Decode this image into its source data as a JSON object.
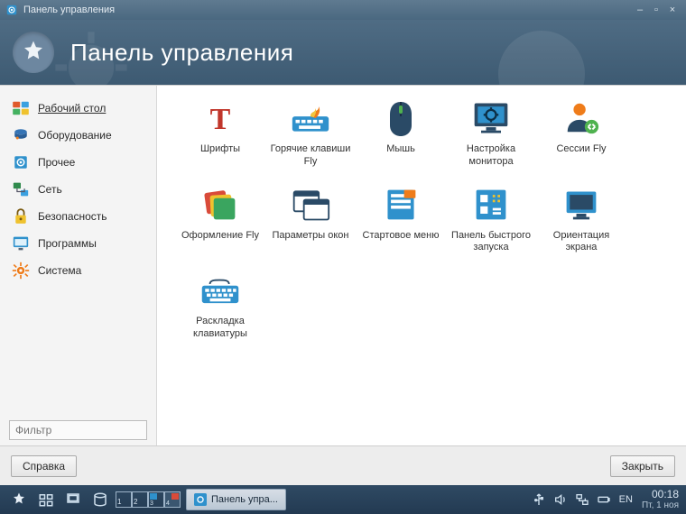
{
  "colors": {
    "accent": "#2f91cc",
    "header": "#456782",
    "orange": "#ef7c1a",
    "green": "#4fb24f"
  },
  "window": {
    "title": "Панель управления"
  },
  "header": {
    "title": "Панель управления"
  },
  "sidebar": {
    "items": [
      {
        "label": "Рабочий стол",
        "icon": "desktop"
      },
      {
        "label": "Оборудование",
        "icon": "hardware"
      },
      {
        "label": "Прочее",
        "icon": "other"
      },
      {
        "label": "Сеть",
        "icon": "network"
      },
      {
        "label": "Безопасность",
        "icon": "security"
      },
      {
        "label": "Программы",
        "icon": "programs"
      },
      {
        "label": "Система",
        "icon": "system"
      }
    ],
    "active_index": 0,
    "filter_placeholder": "Фильтр"
  },
  "content": {
    "tiles": [
      {
        "label": "Шрифты",
        "icon": "fonts"
      },
      {
        "label": "Горячие клавиши Fly",
        "icon": "hotkeys"
      },
      {
        "label": "Мышь",
        "icon": "mouse"
      },
      {
        "label": "Настройка монитора",
        "icon": "monitor-settings"
      },
      {
        "label": "Сессии Fly",
        "icon": "sessions"
      },
      {
        "label": "Оформление Fly",
        "icon": "theme"
      },
      {
        "label": "Параметры окон",
        "icon": "window-params"
      },
      {
        "label": "Стартовое меню",
        "icon": "start-menu"
      },
      {
        "label": "Панель быстрого запуска",
        "icon": "quicklaunch"
      },
      {
        "label": "Ориентация экрана",
        "icon": "orientation"
      },
      {
        "label": "Раскладка клавиатуры",
        "icon": "kb-layout"
      }
    ]
  },
  "buttons": {
    "help": "Справка",
    "close": "Закрыть"
  },
  "taskbar": {
    "workspaces": [
      "1",
      "2",
      "3",
      "4"
    ],
    "active_workspace": 3,
    "task": {
      "label": "Панель упра..."
    },
    "lang": "EN",
    "clock": {
      "time": "00:18",
      "date": "Пт, 1 ноя"
    }
  }
}
